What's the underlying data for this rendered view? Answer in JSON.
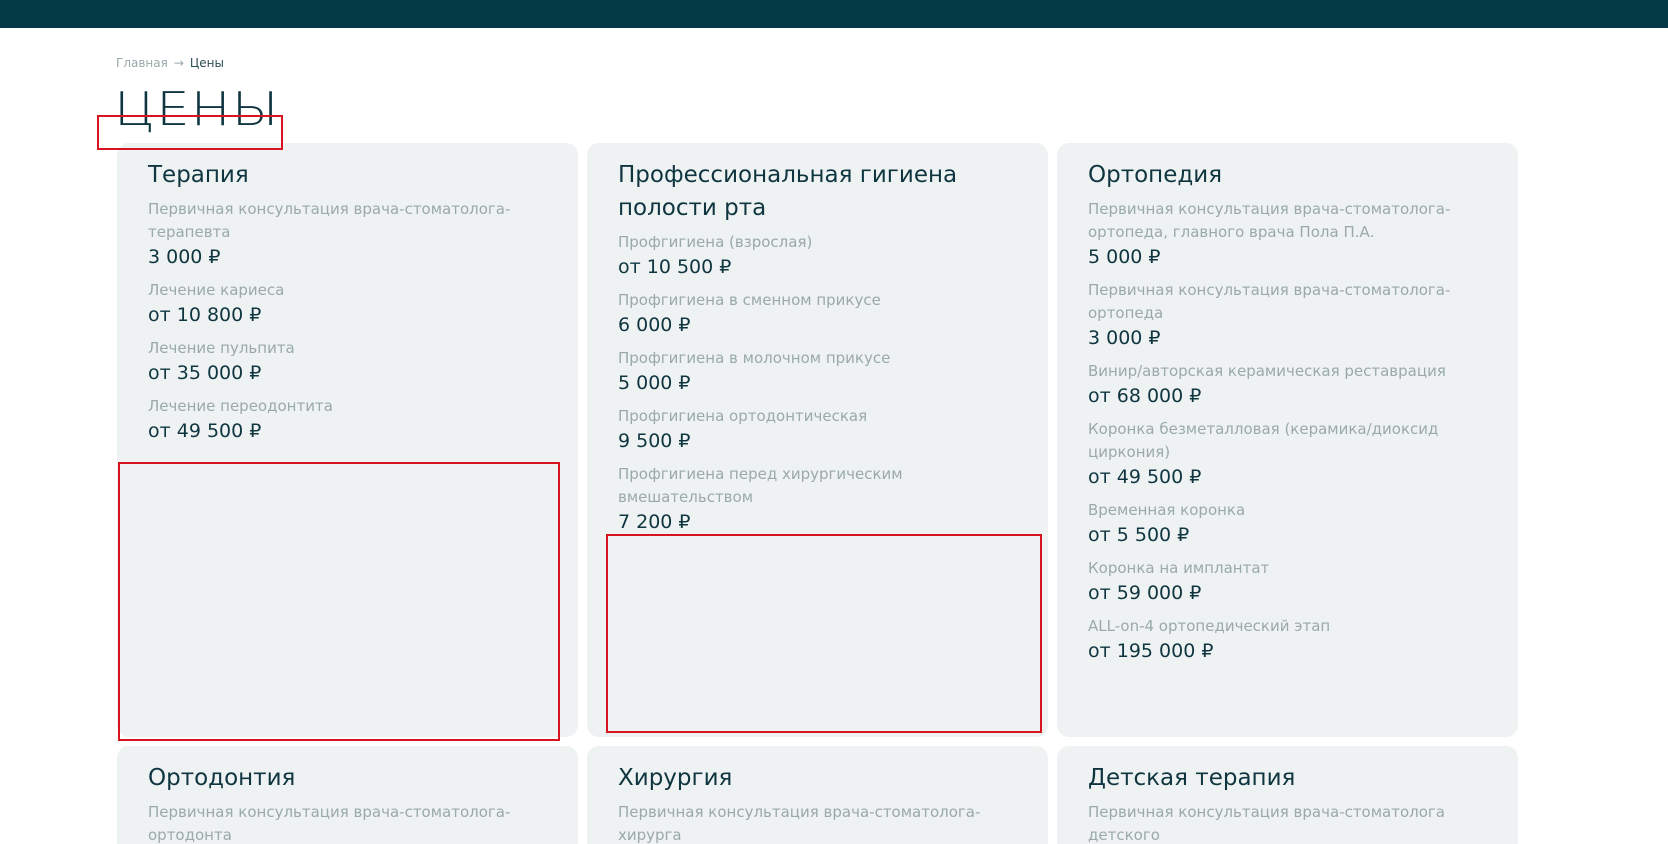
{
  "breadcrumb": {
    "home": "Главная",
    "separator": "→",
    "current": "Цены"
  },
  "page_title": "ЦЕНЫ",
  "colors": {
    "header": "#033a45",
    "card_bg": "#eff2f2",
    "title": "#0f3640",
    "muted": "#9aa9ab",
    "annotation": "#d7141f"
  },
  "cards": [
    {
      "title": "Терапия",
      "items": [
        {
          "name": "Первичная консультация врача-стоматолога-терапевта",
          "price": "3 000 ₽"
        },
        {
          "name": "Лечение кариеса",
          "price": "от 10 800 ₽"
        },
        {
          "name": "Лечение пульпита",
          "price": "от 35 000 ₽"
        },
        {
          "name": "Лечение переодонтита",
          "price": "от 49 500 ₽"
        }
      ]
    },
    {
      "title": "Профессиональная гигиена полости рта",
      "items": [
        {
          "name": "Профгигиена (взрослая)",
          "price": "от 10 500 ₽"
        },
        {
          "name": "Профгигиена в сменном прикусе",
          "price": "6 000 ₽"
        },
        {
          "name": "Профгигиена в молочном прикусе",
          "price": "5 000 ₽"
        },
        {
          "name": "Профгигиена ортодонтическая",
          "price": "9 500 ₽"
        },
        {
          "name": "Профгигиена перед хирургическим вмешательством",
          "price": "7 200 ₽"
        }
      ]
    },
    {
      "title": "Ортопедия",
      "items": [
        {
          "name": "Первичная консультация врача-стоматолога-ортопеда, главного врача Пола П.А.",
          "price": "5 000 ₽"
        },
        {
          "name": "Первичная консультация врача-стоматолога-ортопеда",
          "price": "3 000 ₽"
        },
        {
          "name": "Винир/авторская керамическая реставрация",
          "price": "от 68 000 ₽"
        },
        {
          "name": "Коронка безметалловая (керамика/диоксид циркония)",
          "price": "от 49 500 ₽"
        },
        {
          "name": "Временная коронка",
          "price": "от 5 500 ₽"
        },
        {
          "name": "Коронка на имплантат",
          "price": "от 59 000 ₽"
        },
        {
          "name": "ALL-on-4 ортопедический этап",
          "price": "от 195 000 ₽"
        }
      ]
    },
    {
      "title": "Ортодонтия",
      "items": [
        {
          "name": "Первичная консультация врача-стоматолога-ортодонта",
          "price": ""
        }
      ]
    },
    {
      "title": "Хирургия",
      "items": [
        {
          "name": "Первичная консультация врача-стоматолога-хирурга",
          "price": ""
        }
      ]
    },
    {
      "title": "Детская терапия",
      "items": [
        {
          "name": "Первичная консультация врача-стоматолога детского",
          "price": ""
        }
      ]
    }
  ]
}
